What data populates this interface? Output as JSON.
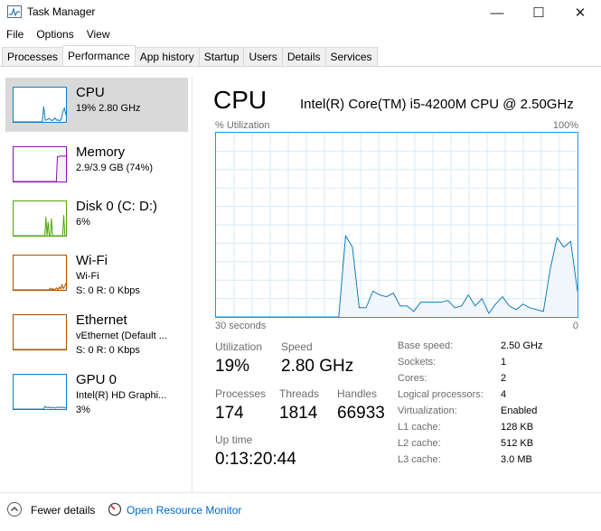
{
  "window": {
    "title": "Task Manager",
    "minimize_glyph": "—",
    "maximize_glyph": "☐",
    "close_glyph": "✕"
  },
  "menu": [
    "File",
    "Options",
    "View"
  ],
  "tabs": [
    "Processes",
    "Performance",
    "App history",
    "Startup",
    "Users",
    "Details",
    "Services"
  ],
  "active_tab": "Performance",
  "sidebar": {
    "items": [
      {
        "name": "CPU",
        "sub1": "19% 2.80 GHz",
        "sub2": "",
        "color": "#117dbb",
        "fill": "#f1f6fa",
        "selected": true
      },
      {
        "name": "Memory",
        "sub1": "2.9/3.9 GB (74%)",
        "sub2": "",
        "color": "#8b12ae",
        "fill": "#f4f2f4"
      },
      {
        "name": "Disk 0 (C: D:)",
        "sub1": "6%",
        "sub2": "",
        "color": "#4da60c",
        "fill": "#eff7eb"
      },
      {
        "name": "Wi-Fi",
        "sub1": "Wi-Fi",
        "sub2": "S: 0 R: 0 Kbps",
        "color": "#a74f01",
        "fill": "#fcf3eb"
      },
      {
        "name": "Ethernet",
        "sub1": "vEthernet (Default ...",
        "sub2": "S: 0 R: 0 Kbps",
        "color": "#a74f01",
        "fill": "#fcf3eb"
      },
      {
        "name": "GPU 0",
        "sub1": "Intel(R) HD Graphi...",
        "sub2": "3%",
        "color": "#117dbb",
        "fill": "#f1f6fa"
      }
    ]
  },
  "main": {
    "title": "CPU",
    "model": "Intel(R) Core(TM) i5-4200M CPU @ 2.50GHz",
    "graph": {
      "y_label": "% Utilization",
      "y_max_label": "100%",
      "x_left_label": "30 seconds",
      "x_right_label": "0",
      "line_color": "#117dbb",
      "fill_color": "#f1f6fa",
      "grid_color": "#d9eaf4",
      "series_percent": [
        0,
        0,
        0,
        0,
        0,
        0,
        0,
        0,
        0,
        0,
        0,
        0,
        0,
        0,
        0,
        0,
        0,
        0,
        0,
        44,
        38,
        5,
        5,
        14,
        12,
        11,
        13,
        6,
        6,
        3,
        8,
        8,
        8,
        8,
        9,
        5,
        6,
        12,
        6,
        10,
        2,
        7,
        11,
        6,
        4,
        7,
        5,
        4,
        3,
        26,
        43,
        38,
        41,
        14
      ]
    },
    "stats": {
      "utilization_label": "Utilization",
      "utilization": "19%",
      "speed_label": "Speed",
      "speed": "2.80 GHz",
      "processes_label": "Processes",
      "processes": "174",
      "threads_label": "Threads",
      "threads": "1814",
      "handles_label": "Handles",
      "handles": "66933",
      "uptime_label": "Up time",
      "uptime": "0:13:20:44"
    },
    "specs": [
      {
        "key": "Base speed:",
        "value": "2.50 GHz"
      },
      {
        "key": "Sockets:",
        "value": "1"
      },
      {
        "key": "Cores:",
        "value": "2"
      },
      {
        "key": "Logical processors:",
        "value": "4"
      },
      {
        "key": "Virtualization:",
        "value": "Enabled"
      },
      {
        "key": "L1 cache:",
        "value": "128 KB"
      },
      {
        "key": "L2 cache:",
        "value": "512 KB"
      },
      {
        "key": "L3 cache:",
        "value": "3.0 MB"
      }
    ]
  },
  "footer": {
    "fewer_details": "Fewer details",
    "resource_monitor": "Open Resource Monitor"
  }
}
